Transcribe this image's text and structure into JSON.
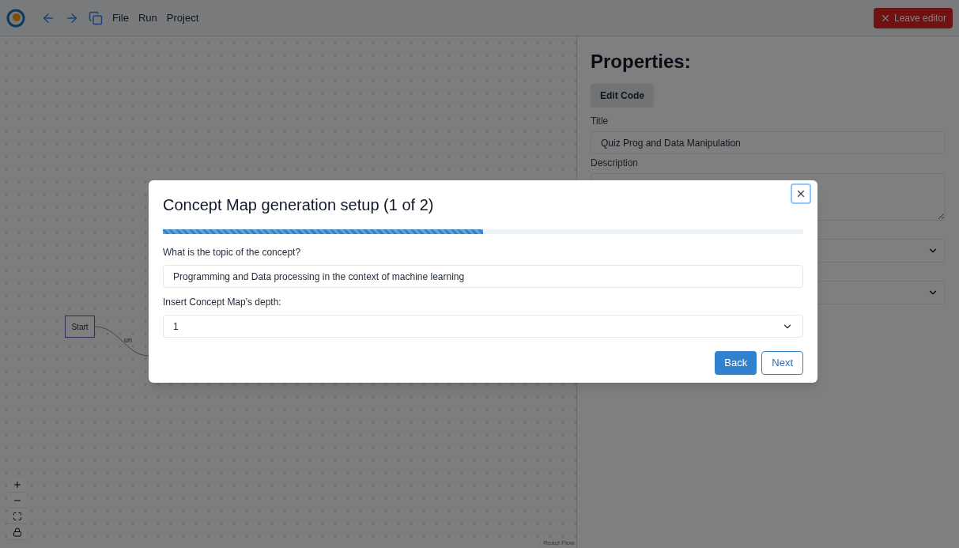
{
  "toolbar": {
    "menus": [
      "File",
      "Run",
      "Project"
    ],
    "leave_button": "Leave editor"
  },
  "canvas": {
    "nodes": [
      {
        "label": "Start",
        "edge_label": "un"
      }
    ],
    "attribution": "React Flow"
  },
  "properties": {
    "heading": "Properties:",
    "edit_code_button": "Edit Code",
    "title_label": "Title",
    "title_value": "Quiz Prog and Data Manipulation",
    "description_label": "Description"
  },
  "dialog": {
    "title": "Concept Map generation setup (1 of 2)",
    "progress": {
      "level": 0.5
    },
    "topic_label": "What is the topic of the concept?",
    "topic_value": "Programming and Data processing in the context of machine learning",
    "depth_label": "Insert Concept Map's depth:",
    "depth_value": "1",
    "buttons": [
      {
        "label": "Back",
        "kind": "primary"
      },
      {
        "label": "Next",
        "kind": "outline"
      }
    ]
  }
}
